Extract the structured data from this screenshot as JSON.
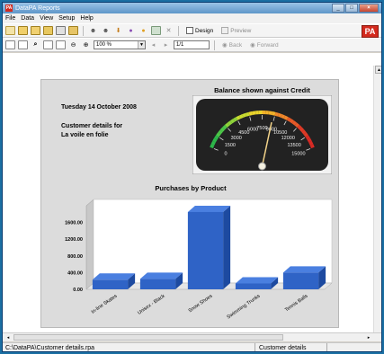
{
  "window": {
    "title": "DataPA Reports",
    "controls": [
      "minimize",
      "maximize",
      "close"
    ]
  },
  "menu": [
    "File",
    "Data",
    "View",
    "Setup",
    "Help"
  ],
  "toolbar1": {
    "icons": [
      "new-report-icon",
      "open-icon",
      "save-icon",
      "save-as-icon",
      "print-icon",
      "export-icon",
      "user-icon",
      "users-icon",
      "download-icon",
      "refresh-icon",
      "folder-icon",
      "grid-icon",
      "delete-icon"
    ],
    "design_label": "Design",
    "preview_label": "Preview",
    "logo_text": "PA"
  },
  "toolbar2": {
    "zoom_value": "100 %",
    "page_value": "1/1",
    "back_label": "Back",
    "forward_label": "Forward"
  },
  "report": {
    "date": "Tuesday 14 October 2008",
    "customer_line1": "Customer details for",
    "customer_line2": "La voile en folie"
  },
  "gauge": {
    "title": "Balance shown against Credit",
    "ticks": [
      "0",
      "1500",
      "3000",
      "4500",
      "6000",
      "7500",
      "9000",
      "10500",
      "12000",
      "13500",
      "15000"
    ],
    "min": 0,
    "max": 15000,
    "needle_value": 8800
  },
  "chart_data": {
    "type": "bar",
    "title": "Purchases by Product",
    "categories": [
      "In-line Skates",
      "Unisex - Black",
      "Snow Shoes",
      "Swimming Trunks",
      "Tennis Balls"
    ],
    "values": [
      230,
      250,
      1850,
      140,
      400
    ],
    "ylim": [
      0,
      2000
    ],
    "yticks": [
      "0.00",
      "400.00",
      "800.00",
      "1200.00",
      "1600.00"
    ],
    "ytick_values": [
      0,
      400,
      800,
      1200,
      1600
    ],
    "color": "#2f63c6"
  },
  "status": {
    "path": "C:\\DataPA\\Customer details.rpa",
    "document": "Customer details"
  }
}
